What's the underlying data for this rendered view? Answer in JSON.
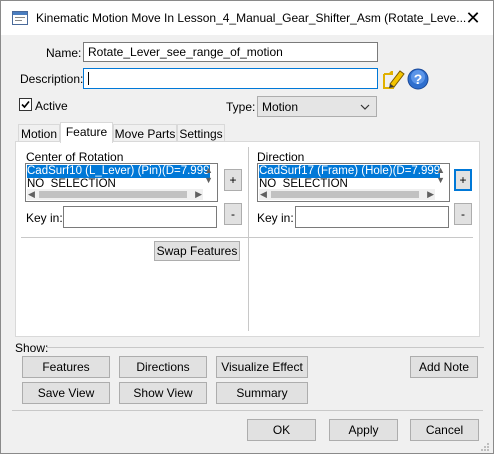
{
  "window": {
    "title": "Kinematic Motion Move In Lesson_4_Manual_Gear_Shifter_Asm (Rotate_Leve...",
    "close_glyph": "✕"
  },
  "form": {
    "name_label": "Name:",
    "name_value": "Rotate_Lever_see_range_of_motion",
    "description_label": "Description:",
    "description_value": "",
    "active_label": "Active",
    "active_checked": true,
    "type_label": "Type:",
    "type_value": "Motion"
  },
  "tabs": [
    {
      "label": "Motion",
      "active": false
    },
    {
      "label": "Feature",
      "active": true
    },
    {
      "label": "Move Parts",
      "active": false
    },
    {
      "label": "Settings",
      "active": false
    }
  ],
  "feature_tab": {
    "center": {
      "label": "Center of Rotation",
      "items": [
        "CadSurf10 (L_Lever) (Pin)(D=7.999",
        "NO_SELECTION"
      ],
      "selected_index": 0,
      "add_label": "+",
      "remove_label": "-",
      "key_label": "Key in:",
      "key_value": ""
    },
    "direction": {
      "label": "Direction",
      "items": [
        "CadSurf17 (Frame) (Hole)(D=7.999",
        "NO_SELECTION"
      ],
      "selected_index": 0,
      "add_label": "+",
      "remove_label": "-",
      "key_label": "Key in:",
      "key_value": ""
    },
    "swap_label": "Swap Features"
  },
  "show": {
    "label": "Show:",
    "buttons": {
      "features": "Features",
      "directions": "Directions",
      "visualize": "Visualize Effect",
      "add_note": "Add Note",
      "save_view": "Save View",
      "show_view": "Show View",
      "summary": "Summary"
    }
  },
  "footer": {
    "ok": "OK",
    "apply": "Apply",
    "cancel": "Cancel"
  },
  "icons": {
    "app": "app-icon",
    "close": "close-icon",
    "edit_description": "edit-pencil-icon",
    "help": "help-icon",
    "dropdown": "chevron-down-icon"
  },
  "colors": {
    "selection": "#0078d7",
    "focus_border": "#0078d7",
    "pencil": "#e0b000",
    "help": "#2f6fce"
  }
}
